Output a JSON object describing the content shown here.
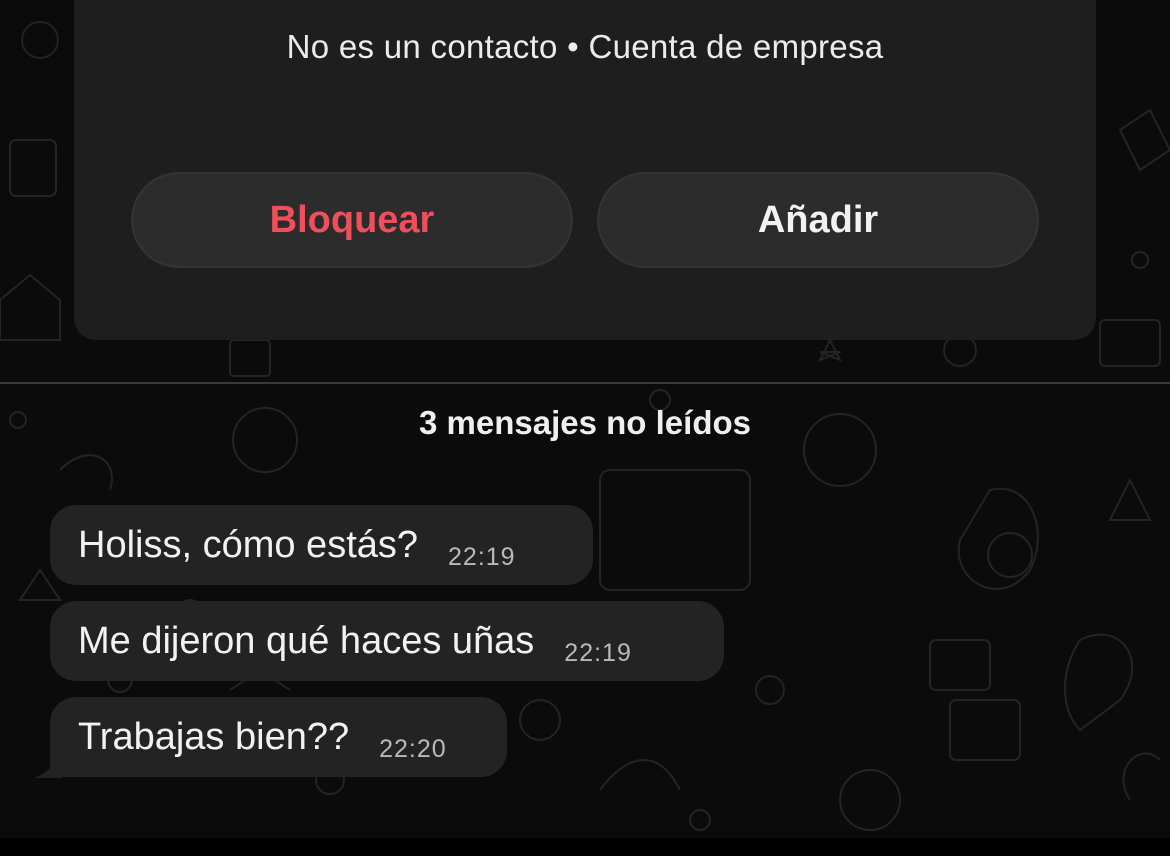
{
  "contact_card": {
    "status": "No es un contacto • Cuenta de empresa",
    "block_label": "Bloquear",
    "add_label": "Añadir"
  },
  "divider_label": "3 mensajes no leídos",
  "messages": [
    {
      "text": "Holiss, cómo estás?",
      "time": "22:19"
    },
    {
      "text": "Me dijeron qué haces uñas",
      "time": "22:19"
    },
    {
      "text": "Trabajas bien??",
      "time": "22:20"
    }
  ],
  "colors": {
    "background": "#0b0b0b",
    "card": "#1e1e1f",
    "bubble": "#232324",
    "danger": "#ee4f5a",
    "text": "#f2f2f2"
  }
}
